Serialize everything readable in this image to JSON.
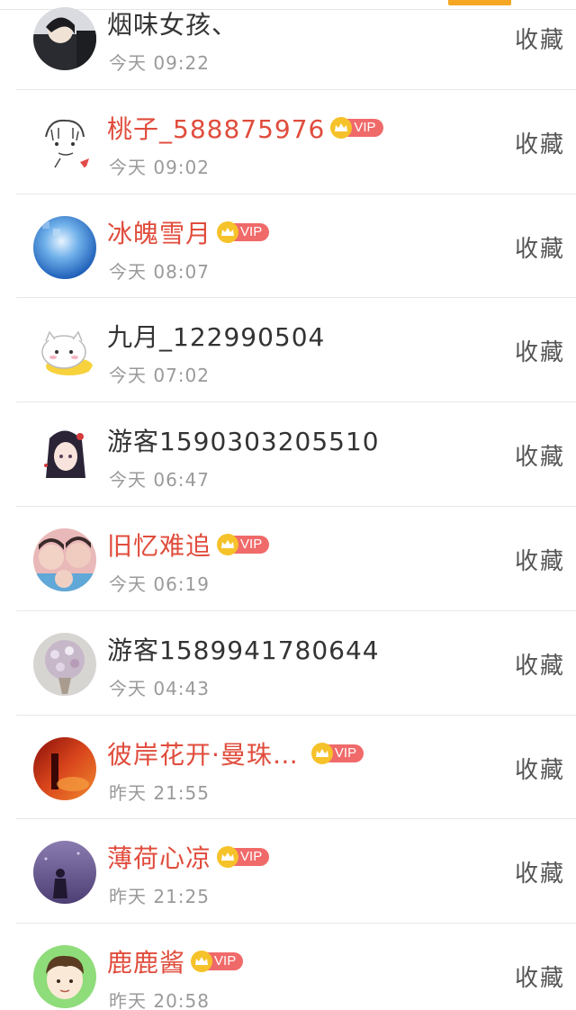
{
  "accent_color": "#f5a623",
  "vip_name_color": "#e04c3c",
  "visitors": [
    {
      "name": "烟味女孩、",
      "time": "今天 09:22",
      "vip": false,
      "vip_label": "",
      "action": "收藏",
      "avatar": "dark-portrait"
    },
    {
      "name": "桃子_588875976",
      "time": "今天 09:02",
      "vip": true,
      "vip_label": "VIP",
      "action": "收藏",
      "avatar": "sketch-face"
    },
    {
      "name": "冰魄雪月",
      "time": "今天 08:07",
      "vip": true,
      "vip_label": "VIP",
      "action": "收藏",
      "avatar": "blue-sky"
    },
    {
      "name": "九月_122990504",
      "time": "今天 07:02",
      "vip": false,
      "vip_label": "",
      "action": "收藏",
      "avatar": "white-cat"
    },
    {
      "name": "游客1590303205510",
      "time": "今天 06:47",
      "vip": false,
      "vip_label": "",
      "action": "收藏",
      "avatar": "anime-girl"
    },
    {
      "name": "旧忆难追",
      "time": "今天 06:19",
      "vip": true,
      "vip_label": "VIP",
      "action": "收藏",
      "avatar": "group-photo"
    },
    {
      "name": "游客1589941780644",
      "time": "今天 04:43",
      "vip": false,
      "vip_label": "",
      "action": "收藏",
      "avatar": "flower-bouquet"
    },
    {
      "name": "彼岸花开·曼珠…",
      "time": "昨天 21:55",
      "vip": true,
      "vip_label": "VIP",
      "action": "收藏",
      "avatar": "red-scene"
    },
    {
      "name": "薄荷心凉",
      "time": "昨天 21:25",
      "vip": true,
      "vip_label": "VIP",
      "action": "收藏",
      "avatar": "purple-silhouette"
    },
    {
      "name": "鹿鹿酱",
      "time": "昨天 20:58",
      "vip": true,
      "vip_label": "VIP",
      "action": "收藏",
      "avatar": "cartoon-boy"
    }
  ]
}
